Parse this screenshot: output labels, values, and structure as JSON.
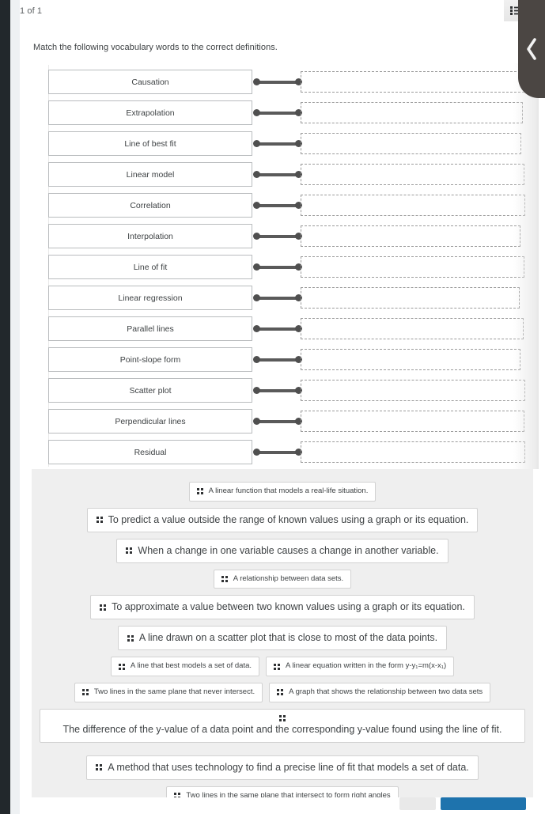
{
  "header": {
    "page_counter": "1 of 1",
    "list_icon": "list-icon",
    "collapse_icon": "chevron-left-icon"
  },
  "prompt": "Match the following vocabulary words to the correct definitions.",
  "match": {
    "terms": [
      "Causation",
      "Extrapolation",
      "Line of best fit",
      "Linear model",
      "Correlation",
      "Interpolation",
      "Line of fit",
      "Linear regression",
      "Parallel lines",
      "Point-slope form",
      "Scatter plot",
      "Perpendicular lines",
      "Residual"
    ]
  },
  "tray": {
    "grip_icon": "drag-handle-icon",
    "tiles": [
      {
        "text": "A linear function that models a real-life situation.",
        "size": "sm"
      },
      {
        "text": "To predict a value outside the range of known values using a graph or its equation.",
        "size": "md"
      },
      {
        "text": "When a change in one variable causes a change in another variable.",
        "size": "md"
      },
      {
        "text": "A relationship between data sets.",
        "size": "sm"
      },
      {
        "text": "To approximate a value between two known values using a graph or its equation.",
        "size": "md"
      },
      {
        "text": "A line drawn on a scatter plot that is close to most of the data points.",
        "size": "md"
      }
    ],
    "pair_one": [
      {
        "text": "A line that best models a set of data.",
        "size": "sm"
      },
      {
        "text": "A linear equation written in the form y-y₁=m(x-x₁)",
        "size": "sm"
      }
    ],
    "pair_two": [
      {
        "text": "Two lines in the same plane that never intersect.",
        "size": "sm"
      },
      {
        "text": "A graph that shows the relationship between two data sets",
        "size": "sm"
      }
    ],
    "wide_tile": {
      "text": "The difference of the y-value of a data point and the corresponding y-value found using the line of fit."
    },
    "tiles_end": [
      {
        "text": "A method that uses technology to find a precise line of fit that models a set of data.",
        "size": "md"
      },
      {
        "text": "Two lines in the same plane that intersect to form right angles",
        "size": "sm"
      }
    ]
  },
  "footer": {
    "secondary_label": "",
    "primary_label": ""
  },
  "colors": {
    "accent": "#1e73ad",
    "tray_bg": "#efefef",
    "tab_bg": "#4b4643"
  }
}
